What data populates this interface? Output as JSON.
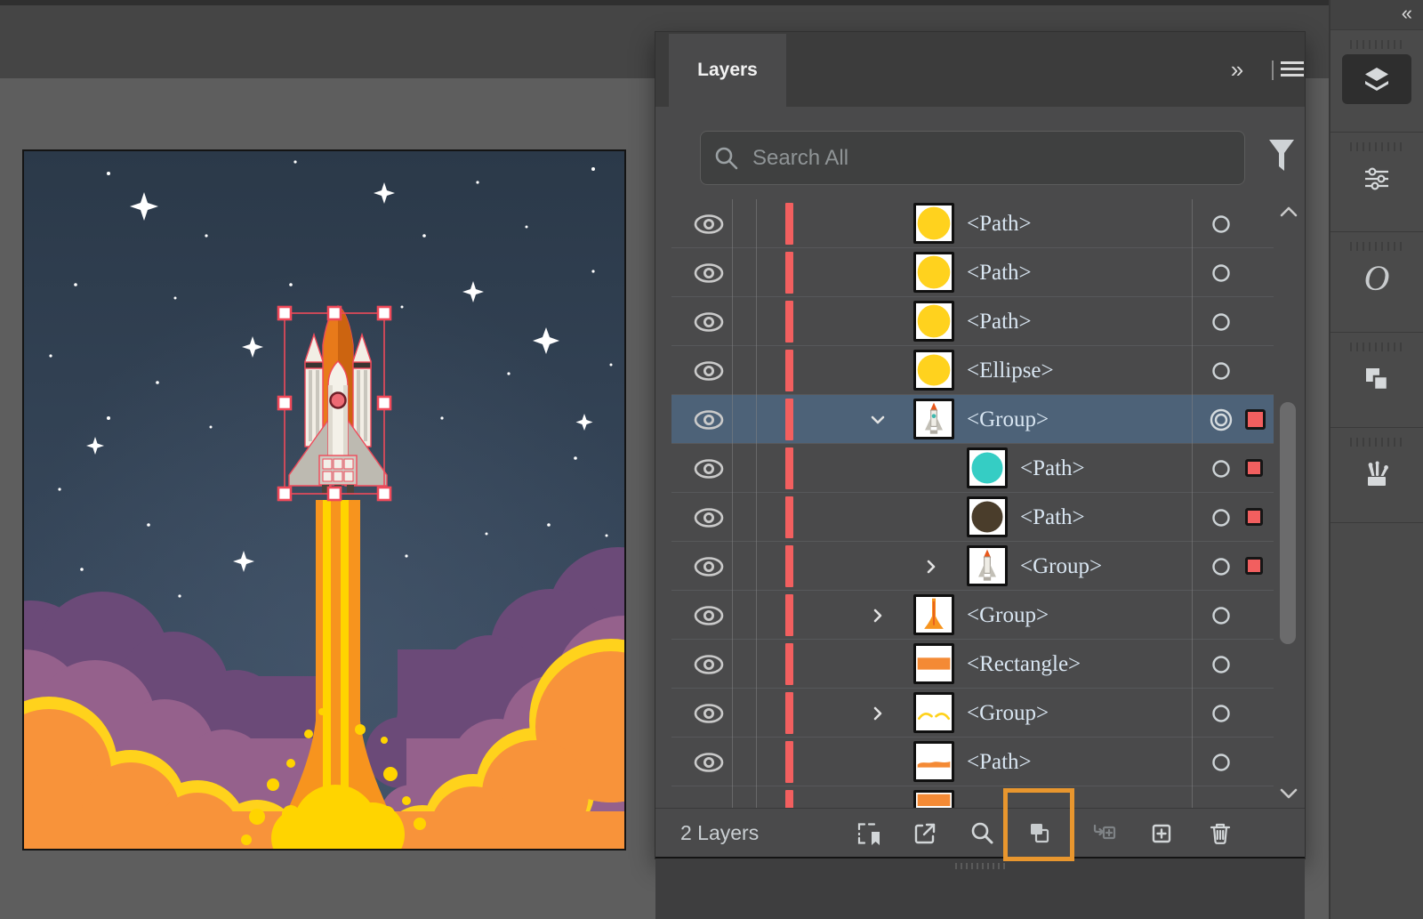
{
  "window": {
    "top_band_color": "#454545",
    "background_color": "#5E5E5E"
  },
  "layers_panel": {
    "tab_title": "Layers",
    "header_icons": [
      "collapse-to-icons",
      "panel-menu"
    ],
    "search": {
      "placeholder": "Search All",
      "value": "",
      "filter_icon": "funnel-icon"
    },
    "accent_color": "#F25F5F",
    "selected_row_color": "#4D6278",
    "highlight_color": "#E8962E",
    "rows": [
      {
        "label": "<Path>",
        "thumbnail": "yellow-circle",
        "indent": 1,
        "chevron": "none",
        "visible": true,
        "target": "ring",
        "selection_square": false,
        "selected": false
      },
      {
        "label": "<Path>",
        "thumbnail": "yellow-circle",
        "indent": 1,
        "chevron": "none",
        "visible": true,
        "target": "ring",
        "selection_square": false,
        "selected": false
      },
      {
        "label": "<Path>",
        "thumbnail": "yellow-circle",
        "indent": 1,
        "chevron": "none",
        "visible": true,
        "target": "ring",
        "selection_square": false,
        "selected": false
      },
      {
        "label": "<Ellipse>",
        "thumbnail": "yellow-circle",
        "indent": 1,
        "chevron": "none",
        "visible": true,
        "target": "ring",
        "selection_square": false,
        "selected": false
      },
      {
        "label": "<Group>",
        "thumbnail": "shuttle",
        "indent": 1,
        "chevron": "down",
        "visible": true,
        "target": "double-ring",
        "selection_square": true,
        "selected": true
      },
      {
        "label": "<Path>",
        "thumbnail": "teal-circle",
        "indent": 2,
        "chevron": "none",
        "visible": true,
        "target": "ring",
        "selection_square": true,
        "selected": false
      },
      {
        "label": "<Path>",
        "thumbnail": "brown-circle",
        "indent": 2,
        "chevron": "none",
        "visible": true,
        "target": "ring",
        "selection_square": true,
        "selected": false
      },
      {
        "label": "<Group>",
        "thumbnail": "shuttle",
        "indent": 2,
        "chevron": "right",
        "visible": true,
        "target": "ring",
        "selection_square": true,
        "selected": false
      },
      {
        "label": "<Group>",
        "thumbnail": "flame",
        "indent": 1,
        "chevron": "right",
        "visible": true,
        "target": "ring",
        "selection_square": false,
        "selected": false
      },
      {
        "label": "<Rectangle>",
        "thumbnail": "orange-band",
        "indent": 1,
        "chevron": "none",
        "visible": true,
        "target": "ring",
        "selection_square": false,
        "selected": false
      },
      {
        "label": "<Group>",
        "thumbnail": "yellow-arcs",
        "indent": 1,
        "chevron": "right",
        "visible": true,
        "target": "ring",
        "selection_square": false,
        "selected": false
      },
      {
        "label": "<Path>",
        "thumbnail": "orange-hills",
        "indent": 1,
        "chevron": "none",
        "visible": true,
        "target": "ring",
        "selection_square": false,
        "selected": false
      },
      {
        "label": "",
        "thumbnail": "orange-partial",
        "indent": 1,
        "chevron": "none",
        "visible": true,
        "target": "ring",
        "selection_square": false,
        "selected": false,
        "clipped": true
      }
    ],
    "status_text": "2 Layers",
    "footer_tools": [
      {
        "name": "collect-for-export",
        "enabled": true,
        "highlighted": false
      },
      {
        "name": "export-selection",
        "enabled": true,
        "highlighted": false
      },
      {
        "name": "locate-object",
        "enabled": true,
        "highlighted": false
      },
      {
        "name": "make-release-clipping-mask",
        "enabled": true,
        "highlighted": true
      },
      {
        "name": "create-new-sublayer",
        "enabled": false,
        "highlighted": false
      },
      {
        "name": "create-new-layer",
        "enabled": true,
        "highlighted": false
      },
      {
        "name": "delete-selection",
        "enabled": true,
        "highlighted": false
      }
    ]
  },
  "dock": {
    "collapse_icon": "expand-panels-chevrons",
    "buttons": [
      {
        "name": "layers-panel",
        "active": true
      },
      {
        "name": "properties-panel",
        "active": false
      },
      {
        "name": "opentype-panel",
        "active": false
      },
      {
        "name": "artboards-panel",
        "active": false
      },
      {
        "name": "brushes-panel",
        "active": false
      }
    ]
  },
  "canvas": {
    "sky_top": "#2B3949",
    "sky_bottom": "#3E5066",
    "star_color": "#FFFFFF",
    "cloud_back": "#6B4A78",
    "cloud_mid": "#95618C",
    "cloud_front": "#F8933A",
    "cloud_outline": "#FFD21C",
    "flame_orange": "#F7941E",
    "flame_yellow": "#FFD400",
    "selection_color": "#EF4A5A"
  }
}
